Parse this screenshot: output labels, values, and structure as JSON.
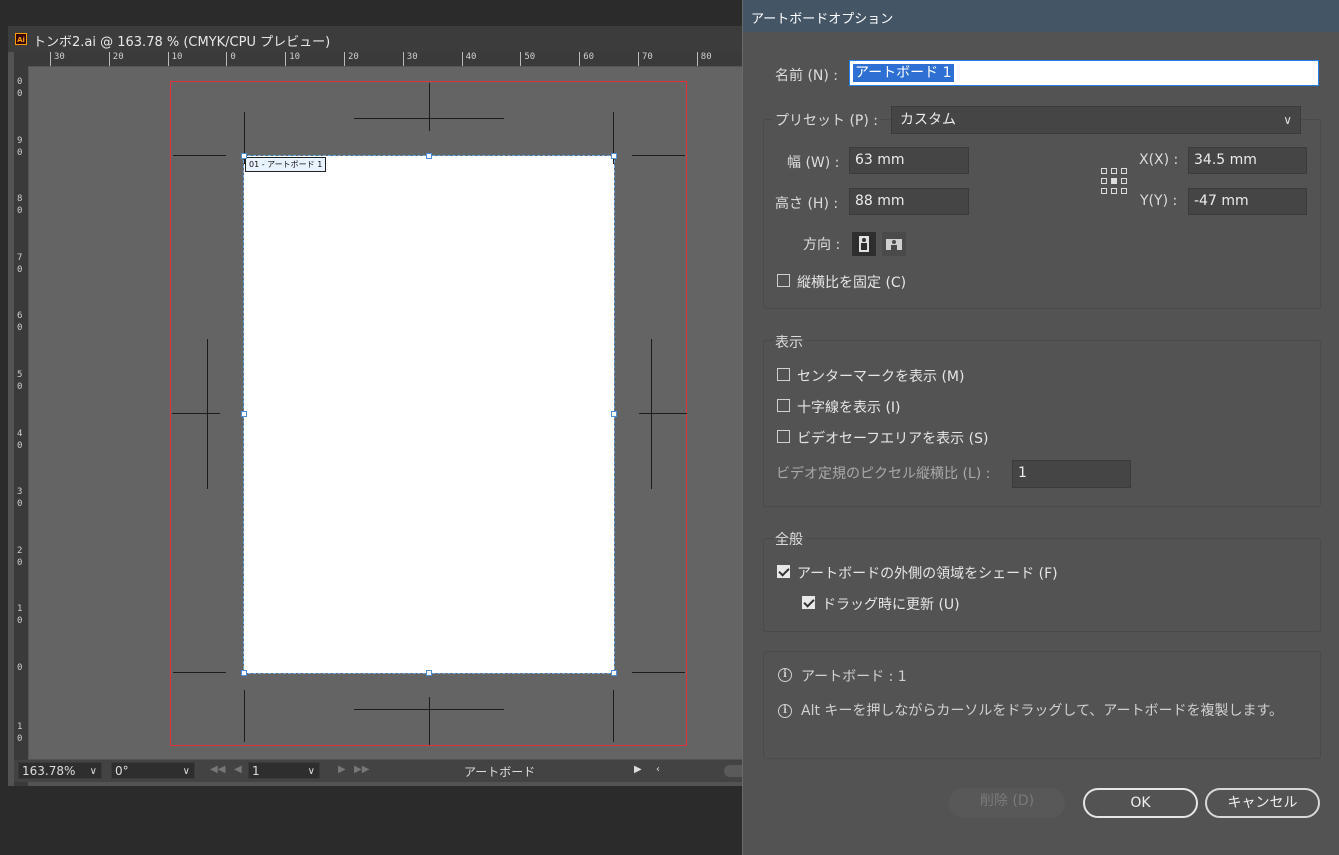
{
  "document": {
    "icon_text": "Ai",
    "title": "トンボ2.ai @ 163.78 % (CMYK/CPU プレビュー)",
    "h_ruler_labels": [
      "30",
      "20",
      "10",
      "0",
      "10",
      "20",
      "30",
      "40",
      "50",
      "60",
      "70",
      "80"
    ],
    "v_ruler_labels": [
      "0 0",
      "9 0",
      "8 0",
      "7 0",
      "6 0",
      "5 0",
      "4 0",
      "3 0",
      "2 0",
      "1 0",
      "0",
      "1 0"
    ],
    "artboard_label": "01 - アートボード 1",
    "status": {
      "zoom": "163.78%",
      "rotation": "0°",
      "artboard_number": "1",
      "mode_label": "アートボード"
    }
  },
  "dialog": {
    "title": "アートボードオプション",
    "name_label": "名前 (N) :",
    "name_value": "アートボード 1",
    "preset_label": "プリセット (P) :",
    "preset_value": "カスタム",
    "width_label": "幅 (W) :",
    "width_value": "63 mm",
    "height_label": "高さ (H) :",
    "height_value": "88 mm",
    "x_label": "X(X) :",
    "x_value": "34.5 mm",
    "y_label": "Y(Y) :",
    "y_value": "-47 mm",
    "orientation_label": "方向 :",
    "constrain_label": "縦横比を固定 (C)",
    "constrain_checked": false,
    "display_section": "表示",
    "show_center_mark": {
      "label": "センターマークを表示 (M)",
      "checked": false
    },
    "show_cross_hairs": {
      "label": "十字線を表示 (I)",
      "checked": false
    },
    "show_video_safe": {
      "label": "ビデオセーフエリアを表示 (S)",
      "checked": false
    },
    "video_ratio_label": "ビデオ定規のピクセル縦横比 (L) :",
    "video_ratio_value": "1",
    "general_section": "全般",
    "fade_outside": {
      "label": "アートボードの外側の領域をシェード (F)",
      "checked": true
    },
    "update_drag": {
      "label": "ドラッグ時に更新 (U)",
      "checked": true
    },
    "info_artboards": "アートボード : 1",
    "info_alt": "Alt キーを押しながらカーソルをドラッグして、アートボードを複製します。",
    "info_icon_glyph": "i",
    "delete_label": "削除 (D)",
    "ok_label": "OK",
    "cancel_label": "キャンセル"
  }
}
